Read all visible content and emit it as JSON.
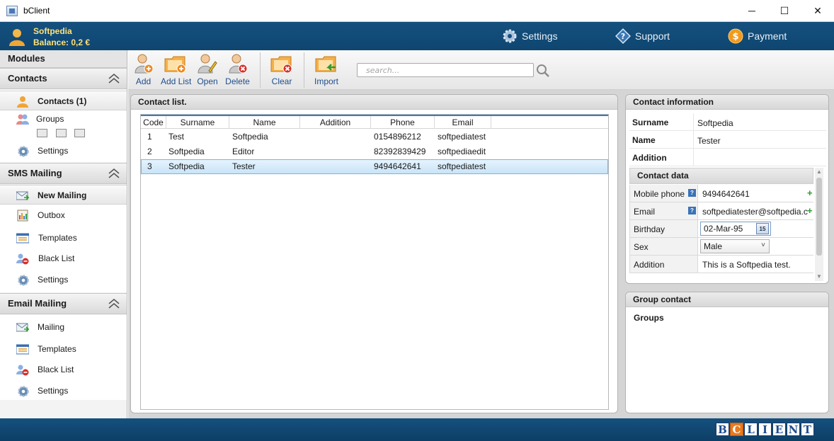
{
  "window": {
    "title": "bClient",
    "minimize_glyph": "─",
    "maximize_glyph": "☐",
    "close_glyph": "✕"
  },
  "header": {
    "user_name": "Softpedia",
    "balance": "Balance: 0,2 €",
    "nav": [
      {
        "label": "Settings",
        "icon": "gear-icon"
      },
      {
        "label": "Support",
        "icon": "help-diamond-icon"
      },
      {
        "label": "Payment",
        "icon": "dollar-coin-icon"
      }
    ]
  },
  "sidebar": {
    "title": "Modules",
    "sections": [
      {
        "title": "Contacts",
        "items": [
          {
            "label": "Contacts (1)",
            "icon": "person-icon",
            "selected": true
          },
          {
            "label": "Groups",
            "icon": "group-icon"
          },
          {
            "label": "Settings",
            "icon": "gear-icon"
          }
        ]
      },
      {
        "title": "SMS Mailing",
        "items": [
          {
            "label": "New Mailing",
            "icon": "new-mail-icon",
            "selected": true
          },
          {
            "label": "Outbox",
            "icon": "outbox-icon"
          },
          {
            "label": "Templates",
            "icon": "template-icon"
          },
          {
            "label": "Black List",
            "icon": "blacklist-icon"
          },
          {
            "label": "Settings",
            "icon": "gear-icon"
          }
        ]
      },
      {
        "title": "Email Mailing",
        "items": [
          {
            "label": "Mailing",
            "icon": "mail-icon"
          },
          {
            "label": "Templates",
            "icon": "template-icon"
          },
          {
            "label": "Black List",
            "icon": "blacklist-icon"
          },
          {
            "label": "Settings",
            "icon": "gear-icon"
          }
        ]
      }
    ]
  },
  "toolbar": {
    "buttons": [
      {
        "label": "Add",
        "icon": "add-contact-icon"
      },
      {
        "label": "Add List",
        "icon": "add-folder-icon"
      },
      {
        "label": "Open",
        "icon": "edit-contact-icon"
      },
      {
        "label": "Delete",
        "icon": "delete-contact-icon"
      },
      {
        "label": "Clear",
        "icon": "clear-folder-icon"
      },
      {
        "label": "Import",
        "icon": "import-folder-icon"
      }
    ],
    "search_placeholder": "search..."
  },
  "contact_list": {
    "title": "Contact list.",
    "columns": [
      "Code",
      "Surname",
      "Name",
      "Addition",
      "Phone",
      "Email"
    ],
    "rows": [
      {
        "code": "1",
        "surname": "Test",
        "name": "Softpedia",
        "addition": "",
        "phone": "0154896212",
        "email": "softpediatest"
      },
      {
        "code": "2",
        "surname": "Softpedia",
        "name": "Editor",
        "addition": "",
        "phone": "82392839429",
        "email": "softpediaedit"
      },
      {
        "code": "3",
        "surname": "Softpedia",
        "name": "Tester",
        "addition": "",
        "phone": "9494642641",
        "email": "softpediatest",
        "selected": true
      }
    ]
  },
  "contact_info": {
    "title": "Contact information",
    "fields": [
      {
        "label": "Surname",
        "value": "Softpedia"
      },
      {
        "label": "Name",
        "value": "Tester"
      },
      {
        "label": "Addition",
        "value": ""
      }
    ],
    "contact_data_title": "Contact data",
    "contact_data": {
      "mobile_label": "Mobile phone",
      "mobile_value": "9494642641",
      "email_label": "Email",
      "email_value": "softpediatester@softpedia.c",
      "birthday_label": "Birthday",
      "birthday_value": "02-Mar-95",
      "calendar_glyph": "15",
      "sex_label": "Sex",
      "sex_value": "Male",
      "addition_label": "Addition",
      "addition_value": "This is a Softpedia test."
    }
  },
  "group_contact": {
    "title": "Group contact",
    "groups_label": "Groups"
  },
  "footer": {
    "logo_letters": [
      "B",
      "C",
      "L",
      "I",
      "E",
      "N",
      "T"
    ]
  }
}
